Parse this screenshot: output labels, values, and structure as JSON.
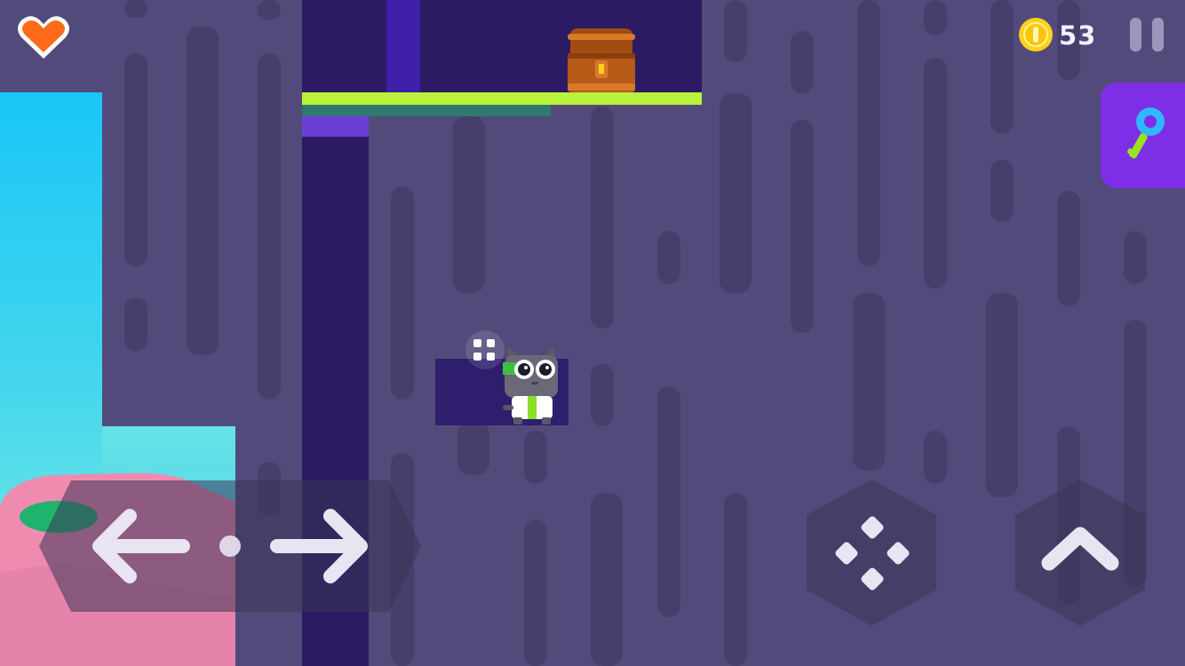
{
  "hud": {
    "coins": "53",
    "heart_icon": "heart-icon",
    "coin_icon": "coin-icon",
    "pause_icon": "pause-icon",
    "key_icon": "key-icon"
  },
  "controls": {
    "left_icon": "arrow-left-icon",
    "right_icon": "arrow-right-icon",
    "action_icon": "diamond-dots-icon",
    "jump_icon": "chevron-up-icon"
  },
  "colors": {
    "background": "#524a7a",
    "platform_green": "#b9f23a",
    "deep_purple": "#2c1a63",
    "heart": "#ff6a1a",
    "coin": "#ffd21a",
    "key_button": "#7c2fe6"
  },
  "scene": {
    "chest_icon": "treasure-chest-icon",
    "player_icon": "cat-character-icon",
    "sparkle_icon": "sparkle-icon",
    "tree_icon": "pink-tree-icon"
  }
}
